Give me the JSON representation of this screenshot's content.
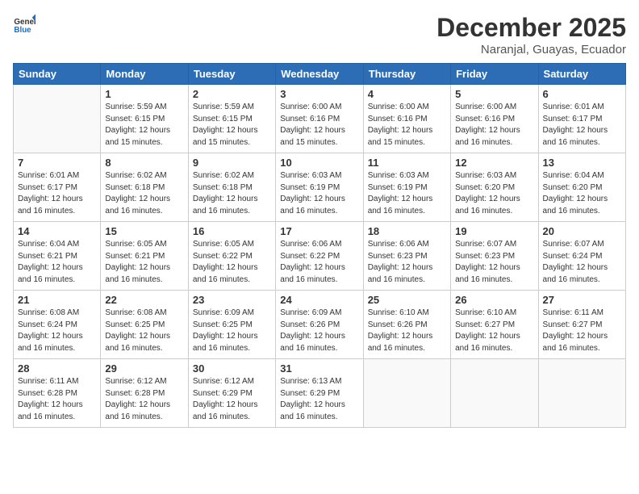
{
  "logo": {
    "general": "General",
    "blue": "Blue"
  },
  "title": {
    "month_year": "December 2025",
    "location": "Naranjal, Guayas, Ecuador"
  },
  "days_of_week": [
    "Sunday",
    "Monday",
    "Tuesday",
    "Wednesday",
    "Thursday",
    "Friday",
    "Saturday"
  ],
  "weeks": [
    [
      {
        "day": "",
        "info": ""
      },
      {
        "day": "1",
        "info": "Sunrise: 5:59 AM\nSunset: 6:15 PM\nDaylight: 12 hours\nand 15 minutes."
      },
      {
        "day": "2",
        "info": "Sunrise: 5:59 AM\nSunset: 6:15 PM\nDaylight: 12 hours\nand 15 minutes."
      },
      {
        "day": "3",
        "info": "Sunrise: 6:00 AM\nSunset: 6:16 PM\nDaylight: 12 hours\nand 15 minutes."
      },
      {
        "day": "4",
        "info": "Sunrise: 6:00 AM\nSunset: 6:16 PM\nDaylight: 12 hours\nand 15 minutes."
      },
      {
        "day": "5",
        "info": "Sunrise: 6:00 AM\nSunset: 6:16 PM\nDaylight: 12 hours\nand 16 minutes."
      },
      {
        "day": "6",
        "info": "Sunrise: 6:01 AM\nSunset: 6:17 PM\nDaylight: 12 hours\nand 16 minutes."
      }
    ],
    [
      {
        "day": "7",
        "info": ""
      },
      {
        "day": "8",
        "info": "Sunrise: 6:02 AM\nSunset: 6:18 PM\nDaylight: 12 hours\nand 16 minutes."
      },
      {
        "day": "9",
        "info": "Sunrise: 6:02 AM\nSunset: 6:18 PM\nDaylight: 12 hours\nand 16 minutes."
      },
      {
        "day": "10",
        "info": "Sunrise: 6:03 AM\nSunset: 6:19 PM\nDaylight: 12 hours\nand 16 minutes."
      },
      {
        "day": "11",
        "info": "Sunrise: 6:03 AM\nSunset: 6:19 PM\nDaylight: 12 hours\nand 16 minutes."
      },
      {
        "day": "12",
        "info": "Sunrise: 6:03 AM\nSunset: 6:20 PM\nDaylight: 12 hours\nand 16 minutes."
      },
      {
        "day": "13",
        "info": "Sunrise: 6:04 AM\nSunset: 6:20 PM\nDaylight: 12 hours\nand 16 minutes."
      }
    ],
    [
      {
        "day": "14",
        "info": ""
      },
      {
        "day": "15",
        "info": "Sunrise: 6:05 AM\nSunset: 6:21 PM\nDaylight: 12 hours\nand 16 minutes."
      },
      {
        "day": "16",
        "info": "Sunrise: 6:05 AM\nSunset: 6:22 PM\nDaylight: 12 hours\nand 16 minutes."
      },
      {
        "day": "17",
        "info": "Sunrise: 6:06 AM\nSunset: 6:22 PM\nDaylight: 12 hours\nand 16 minutes."
      },
      {
        "day": "18",
        "info": "Sunrise: 6:06 AM\nSunset: 6:23 PM\nDaylight: 12 hours\nand 16 minutes."
      },
      {
        "day": "19",
        "info": "Sunrise: 6:07 AM\nSunset: 6:23 PM\nDaylight: 12 hours\nand 16 minutes."
      },
      {
        "day": "20",
        "info": "Sunrise: 6:07 AM\nSunset: 6:24 PM\nDaylight: 12 hours\nand 16 minutes."
      }
    ],
    [
      {
        "day": "21",
        "info": ""
      },
      {
        "day": "22",
        "info": "Sunrise: 6:08 AM\nSunset: 6:25 PM\nDaylight: 12 hours\nand 16 minutes."
      },
      {
        "day": "23",
        "info": "Sunrise: 6:09 AM\nSunset: 6:25 PM\nDaylight: 12 hours\nand 16 minutes."
      },
      {
        "day": "24",
        "info": "Sunrise: 6:09 AM\nSunset: 6:26 PM\nDaylight: 12 hours\nand 16 minutes."
      },
      {
        "day": "25",
        "info": "Sunrise: 6:10 AM\nSunset: 6:26 PM\nDaylight: 12 hours\nand 16 minutes."
      },
      {
        "day": "26",
        "info": "Sunrise: 6:10 AM\nSunset: 6:27 PM\nDaylight: 12 hours\nand 16 minutes."
      },
      {
        "day": "27",
        "info": "Sunrise: 6:11 AM\nSunset: 6:27 PM\nDaylight: 12 hours\nand 16 minutes."
      }
    ],
    [
      {
        "day": "28",
        "info": "Sunrise: 6:11 AM\nSunset: 6:28 PM\nDaylight: 12 hours\nand 16 minutes."
      },
      {
        "day": "29",
        "info": "Sunrise: 6:12 AM\nSunset: 6:28 PM\nDaylight: 12 hours\nand 16 minutes."
      },
      {
        "day": "30",
        "info": "Sunrise: 6:12 AM\nSunset: 6:29 PM\nDaylight: 12 hours\nand 16 minutes."
      },
      {
        "day": "31",
        "info": "Sunrise: 6:13 AM\nSunset: 6:29 PM\nDaylight: 12 hours\nand 16 minutes."
      },
      {
        "day": "",
        "info": ""
      },
      {
        "day": "",
        "info": ""
      },
      {
        "day": "",
        "info": ""
      }
    ]
  ],
  "week1_sunday_info": "Sunrise: 6:01 AM\nSunset: 6:17 PM\nDaylight: 12 hours\nand 16 minutes.",
  "week2_sunday_info": "Sunrise: 6:01 AM\nSunset: 6:17 PM\nDaylight: 12 hours\nand 16 minutes.",
  "week3_sunday_info": "Sunrise: 6:04 AM\nSunset: 6:21 PM\nDaylight: 12 hours\nand 16 minutes.",
  "week4_sunday_info": "Sunrise: 6:08 AM\nSunset: 6:24 PM\nDaylight: 12 hours\nand 16 minutes."
}
